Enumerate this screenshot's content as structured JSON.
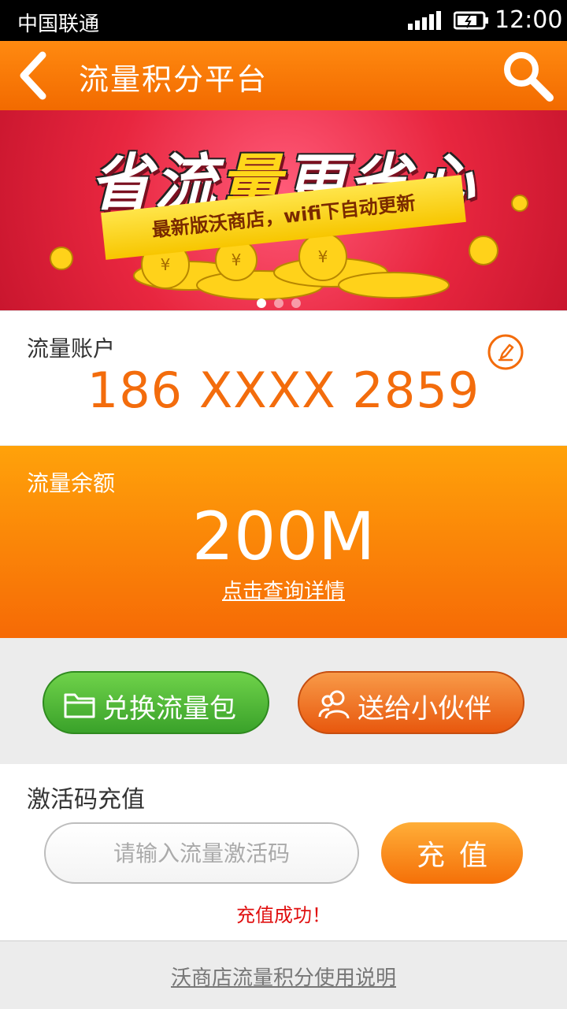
{
  "status_bar": {
    "carrier": "中国联通",
    "time": "12:00"
  },
  "header": {
    "title": "流量积分平台"
  },
  "banner": {
    "headline_part1": "省流",
    "headline_highlight": "量",
    "headline_part2": "更省心",
    "ribbon_text": "最新版沃商店，wifi下自动更新",
    "pages": 3,
    "active_page": 1
  },
  "account": {
    "label": "流量账户",
    "number": "186 XXXX 2859"
  },
  "balance": {
    "label": "流量余额",
    "value": "200M",
    "detail_link": "点击查询详情"
  },
  "actions": {
    "exchange_label": "兑换流量包",
    "gift_label": "送给小伙伴"
  },
  "activation": {
    "label": "激活码充值",
    "placeholder": "请输入流量激活码",
    "submit_label": "充值",
    "message": "充值成功！"
  },
  "footer": {
    "help_link": "沃商店流量积分使用说明"
  },
  "colors": {
    "brand_orange": "#f36c0c",
    "banner_red": "#e8263f",
    "success_green": "#3aa22a",
    "message_red": "#e01010"
  }
}
